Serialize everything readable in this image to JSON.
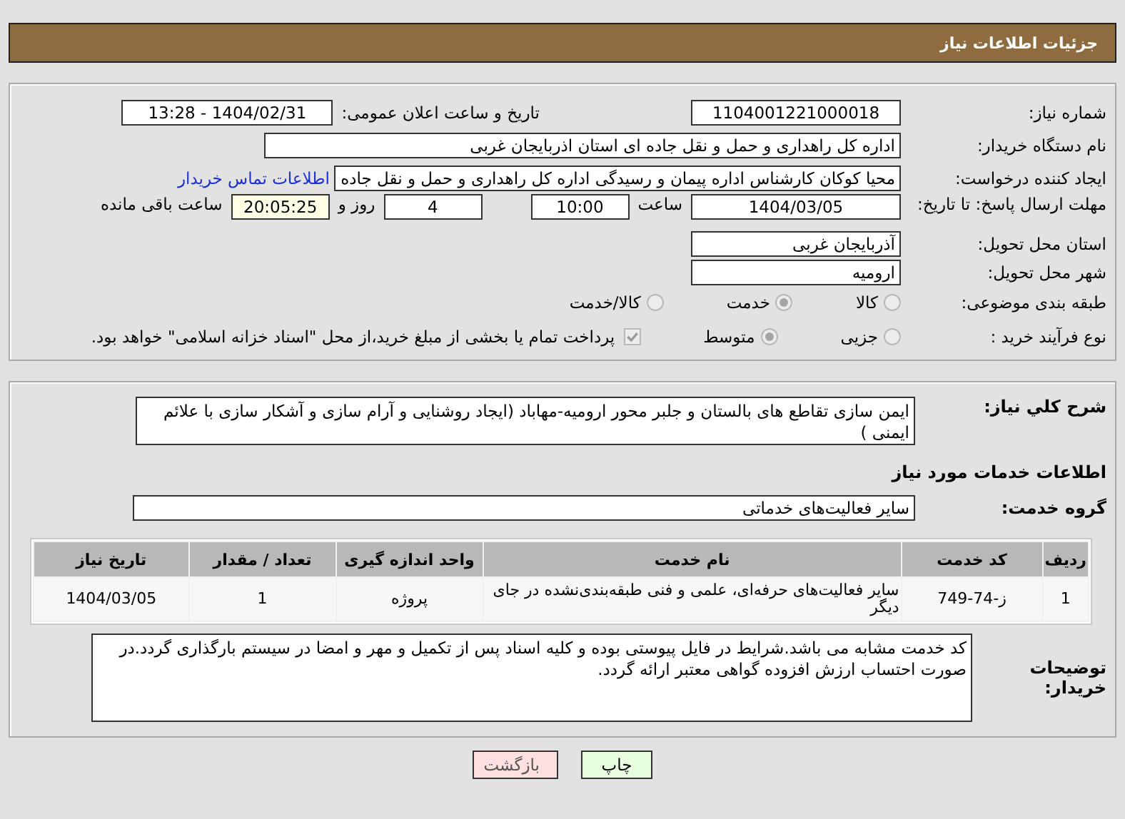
{
  "header": {
    "title": "جزئیات اطلاعات نیاز"
  },
  "need_number": {
    "label": "شماره نیاز:",
    "value": "1104001221000018"
  },
  "announce": {
    "label": "تاریخ و ساعت اعلان عمومی:",
    "value": "1404/02/31 - 13:28"
  },
  "buyer": {
    "label": "نام دستگاه خریدار:",
    "value": "اداره کل راهداری و حمل و نقل جاده ای استان اذربایجان غربی"
  },
  "creator": {
    "label": "ایجاد کننده درخواست:",
    "value": "محیا کوکان کارشناس اداره پیمان و رسیدگی اداره کل راهداری و حمل و نقل جاده",
    "link": "اطلاعات تماس خریدار"
  },
  "deadline": {
    "label": "مهلت ارسال پاسخ: تا تاریخ:",
    "date": "1404/03/05",
    "time_label": "ساعت",
    "time": "10:00",
    "days": "4",
    "days_label": "روز و",
    "remaining": "20:05:25",
    "remaining_label": "ساعت باقی مانده"
  },
  "province": {
    "label": "استان محل تحویل:",
    "value": "آذربایجان غربی"
  },
  "city": {
    "label": "شهر محل تحویل:",
    "value": "ارومیه"
  },
  "category": {
    "label": "طبقه بندی موضوعی:",
    "options": [
      {
        "label": "کالا",
        "selected": false
      },
      {
        "label": "خدمت",
        "selected": true
      },
      {
        "label": "کالا/خدمت",
        "selected": false
      }
    ]
  },
  "process": {
    "label": "نوع فرآیند خرید :",
    "options": [
      {
        "label": "جزیی",
        "selected": false
      },
      {
        "label": "متوسط",
        "selected": true
      }
    ],
    "payment": {
      "checked": true,
      "text": "پرداخت تمام یا بخشی از مبلغ خرید،از محل \"اسناد خزانه اسلامی\" خواهد بود."
    }
  },
  "description": {
    "label": "شرح كلي نياز:",
    "value": "ایمن سازی تقاطع های بالستان و جلبر محور ارومیه-مهاباد (ایجاد روشنایی و آرام سازی و آشکار سازی با علائم ایمنی )"
  },
  "services_title": "اطلاعات خدمات مورد نیاز",
  "service_group": {
    "label": "گروه خدمت:",
    "value": "سایر فعالیت‌های خدماتی"
  },
  "table": {
    "columns": [
      "ردیف",
      "کد خدمت",
      "نام خدمت",
      "واحد اندازه گیری",
      "تعداد / مقدار",
      "تاریخ نیاز"
    ],
    "rows": [
      [
        "1",
        "ز-74-749",
        "سایر فعالیت‌های حرفه‌ای، علمی و فنی طبقه‌بندی‌نشده در جای دیگر",
        "پروژه",
        "1",
        "1404/03/05"
      ]
    ]
  },
  "buyer_notes": {
    "label": "توضیحات خریدار:",
    "value": "کد خدمت مشابه می باشد.شرایط در فایل پیوستی بوده و کلیه اسناد پس از تکمیل و مهر و امضا در سیستم بارگذاری گردد.در صورت احتساب ارزش افزوده گواهی معتبر ارائه گردد."
  },
  "buttons": [
    {
      "label": "چاپ",
      "kind": "print"
    },
    {
      "label": "بازگشت",
      "kind": "back"
    }
  ]
}
